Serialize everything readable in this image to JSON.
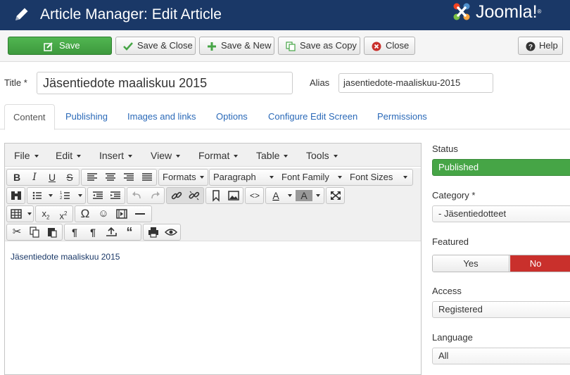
{
  "header": {
    "title": "Article Manager: Edit Article",
    "logo_text": "Joomla!"
  },
  "toolbar": {
    "save": "Save",
    "save_close": "Save & Close",
    "save_new": "Save & New",
    "save_copy": "Save as Copy",
    "close": "Close",
    "help": "Help"
  },
  "form": {
    "title_label": "Title *",
    "title_value": "Jäsentiedote maaliskuu 2015",
    "alias_label": "Alias",
    "alias_value": "jasentiedote-maaliskuu-2015"
  },
  "tabs": [
    "Content",
    "Publishing",
    "Images and links",
    "Options",
    "Configure Edit Screen",
    "Permissions"
  ],
  "editor": {
    "menu": [
      "File",
      "Edit",
      "Insert",
      "View",
      "Format",
      "Table",
      "Tools"
    ],
    "selects": {
      "formats": "Formats",
      "paragraph": "Paragraph",
      "font_family": "Font Family",
      "font_sizes": "Font Sizes"
    },
    "content_text": "Jäsentiedote maaliskuu 2015"
  },
  "sidebar": {
    "status_label": "Status",
    "status_value": "Published",
    "category_label": "Category *",
    "category_value": "- Jäsentiedotteet",
    "featured_label": "Featured",
    "featured_yes": "Yes",
    "featured_no": "No",
    "access_label": "Access",
    "access_value": "Registered",
    "language_label": "Language",
    "language_value": "All"
  },
  "colors": {
    "header_bg": "#1a3867",
    "save_green": "#46a546",
    "no_red": "#c9302c",
    "link_blue": "#2a69b8"
  }
}
